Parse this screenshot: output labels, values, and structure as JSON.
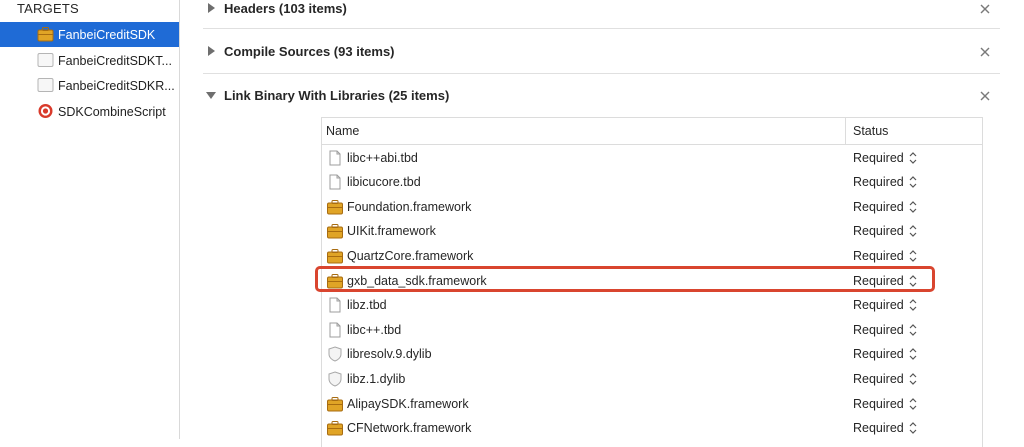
{
  "sidebar": {
    "heading": "TARGETS",
    "targets": [
      {
        "label": "FanbeiCreditSDK",
        "icon": "toolbox-icon",
        "selected": true
      },
      {
        "label": "FanbeiCreditSDKT...",
        "icon": "blank-file-icon",
        "selected": false
      },
      {
        "label": "FanbeiCreditSDKR...",
        "icon": "blank-file-icon",
        "selected": false
      },
      {
        "label": "SDKCombineScript",
        "icon": "target-icon",
        "selected": false
      }
    ]
  },
  "phases": [
    {
      "title": "Headers (103 items)",
      "expanded": false
    },
    {
      "title": "Compile Sources (93 items)",
      "expanded": false
    },
    {
      "title": "Link Binary With Libraries (25 items)",
      "expanded": true
    }
  ],
  "libraries_table": {
    "columns": {
      "name": "Name",
      "status": "Status"
    },
    "rows": [
      {
        "name": "libc++abi.tbd",
        "status": "Required",
        "icon": "file-icon"
      },
      {
        "name": "libicucore.tbd",
        "status": "Required",
        "icon": "file-icon"
      },
      {
        "name": "Foundation.framework",
        "status": "Required",
        "icon": "toolbox-icon"
      },
      {
        "name": "UIKit.framework",
        "status": "Required",
        "icon": "toolbox-icon"
      },
      {
        "name": "QuartzCore.framework",
        "status": "Required",
        "icon": "toolbox-icon"
      },
      {
        "name": "gxb_data_sdk.framework",
        "status": "Required",
        "icon": "toolbox-icon"
      },
      {
        "name": "libz.tbd",
        "status": "Required",
        "icon": "file-icon"
      },
      {
        "name": "libc++.tbd",
        "status": "Required",
        "icon": "file-icon"
      },
      {
        "name": "libresolv.9.dylib",
        "status": "Required",
        "icon": "shield-icon"
      },
      {
        "name": "libz.1.dylib",
        "status": "Required",
        "icon": "shield-icon"
      },
      {
        "name": "AlipaySDK.framework",
        "status": "Required",
        "icon": "toolbox-icon"
      },
      {
        "name": "CFNetwork.framework",
        "status": "Required",
        "icon": "toolbox-icon"
      }
    ]
  },
  "colors": {
    "selection": "#1f6bd6",
    "highlight": "#d9452f",
    "toolbox": "#e0a426"
  }
}
